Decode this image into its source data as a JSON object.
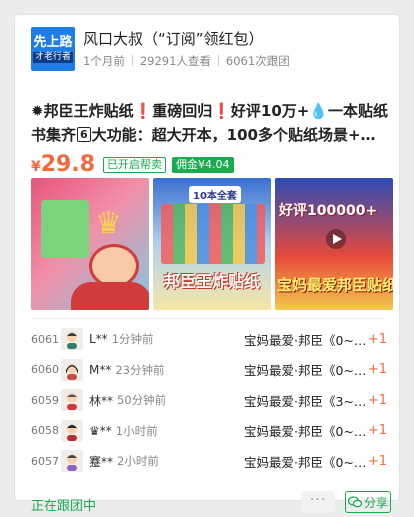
{
  "shop": {
    "logo_line1": "先上路",
    "logo_line2": "オ老行者",
    "name": "风口大叔（“订阅”领红包）",
    "posted": "1个月前",
    "views": "29291人查看",
    "follows": "6061次跟团"
  },
  "product": {
    "title_prefix": "✹邦臣王炸贴纸❗重磅回归❗好评10万+💧一本贴纸书集齐",
    "title_boxed": "6",
    "title_suffix": "大功能：超大开本，100多个贴纸场景+…",
    "price_symbol": "¥",
    "price": "29.8",
    "tag_helper": "已开启帮卖",
    "tag_commission": "佣金¥4.04"
  },
  "images": [
    {
      "icon": "crown-icon"
    },
    {
      "tab": "10本全套",
      "caption": "邦臣王炸贴纸"
    },
    {
      "top": "好评100000+",
      "bottom": "宝妈最爱邦臣贴纸"
    }
  ],
  "orders": [
    {
      "num": "6061",
      "name": "L**",
      "time": "1分钟前",
      "product": "宝妈最爱·邦臣《0~…",
      "plus": "+1"
    },
    {
      "num": "6060",
      "name": "M**",
      "time": "23分钟前",
      "product": "宝妈最爱·邦臣《0~…",
      "plus": "+1"
    },
    {
      "num": "6059",
      "name": "林**",
      "time": "50分钟前",
      "product": "宝妈最爱·邦臣《3~…",
      "plus": "+1"
    },
    {
      "num": "6058",
      "name": "♛**",
      "time": "1小时前",
      "product": "宝妈最爱·邦臣《0~…",
      "plus": "+1"
    },
    {
      "num": "6057",
      "name": "蹇**",
      "time": "2小时前",
      "product": "宝妈最爱·邦臣《0~…",
      "plus": "+1"
    }
  ],
  "footer": {
    "status": "正在跟团中",
    "more": "···",
    "share": "分享"
  },
  "colors": {
    "accent_green": "#1aab4f",
    "price_orange": "#f06a3e",
    "logo_blue": "#1f7de8"
  }
}
